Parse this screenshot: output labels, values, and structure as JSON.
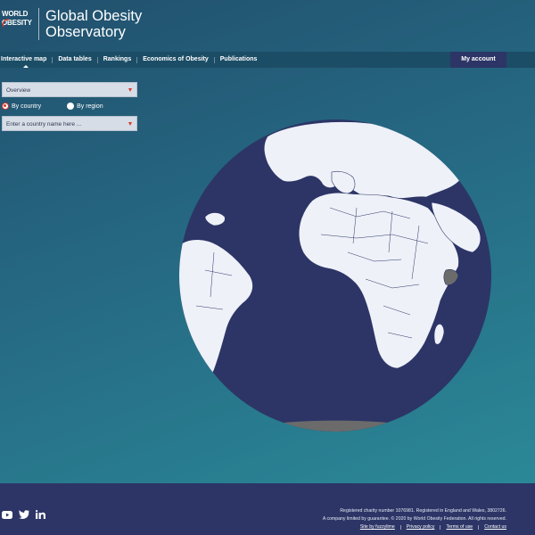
{
  "brand": {
    "logo_line1": "WORLD",
    "logo_line2": "OBESITY",
    "site_title": "Global Obesity\nObservatory"
  },
  "nav": {
    "items": [
      {
        "label": "Interactive map",
        "active": true
      },
      {
        "label": "Data tables"
      },
      {
        "label": "Rankings"
      },
      {
        "label": "Economics of Obesity"
      },
      {
        "label": "Publications"
      }
    ],
    "account_label": "My account"
  },
  "controls": {
    "indicator_select": "Overview",
    "radio_options": [
      {
        "label": "By country",
        "checked": true
      },
      {
        "label": "By region",
        "checked": false
      }
    ],
    "country_placeholder": "Enter a country name here ..."
  },
  "map": {
    "ocean_color": "#2c3566",
    "land_color": "#eef1f8",
    "highlight_color": "#6b6b6b",
    "accent_color": "#d9392b"
  },
  "footer": {
    "social_icons": [
      "youtube-icon",
      "twitter-icon",
      "linkedin-icon"
    ],
    "line1": "Registered charity number 1076981. Registered in England and Wales, 3802726.",
    "line2": "A company limited by guarantee. © 2020 by World Obesity Federation. All rights reserved.",
    "links": [
      "Site by fuzzylime",
      "Privacy policy",
      "Terms of use",
      "Contact us"
    ]
  }
}
